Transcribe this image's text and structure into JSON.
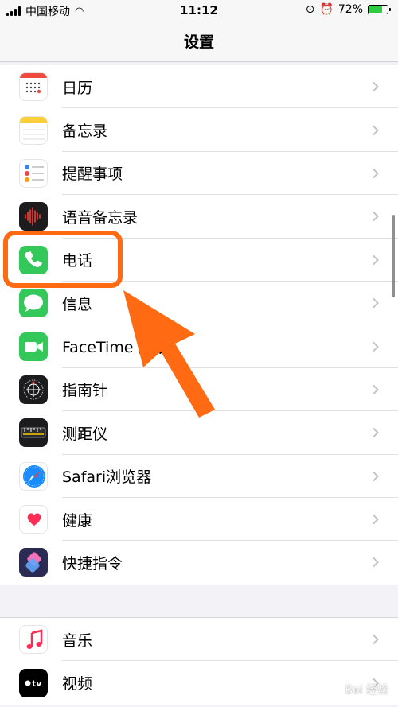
{
  "status_bar": {
    "carrier": "中国移动",
    "time": "11:12",
    "battery": "72%",
    "battery_level": 0.72
  },
  "nav": {
    "title": "设置"
  },
  "group1": {
    "items": [
      {
        "label": "日历",
        "icon": "calendar-icon"
      },
      {
        "label": "备忘录",
        "icon": "notes-icon"
      },
      {
        "label": "提醒事项",
        "icon": "reminders-icon"
      },
      {
        "label": "语音备忘录",
        "icon": "voice-memos-icon"
      },
      {
        "label": "电话",
        "icon": "phone-icon"
      },
      {
        "label": "信息",
        "icon": "messages-icon"
      },
      {
        "label": "FaceTime 通话",
        "icon": "facetime-icon"
      },
      {
        "label": "指南针",
        "icon": "compass-icon"
      },
      {
        "label": "测距仪",
        "icon": "measure-icon"
      },
      {
        "label": "Safari浏览器",
        "icon": "safari-icon"
      },
      {
        "label": "健康",
        "icon": "health-icon"
      },
      {
        "label": "快捷指令",
        "icon": "shortcuts-icon"
      }
    ]
  },
  "group2": {
    "items": [
      {
        "label": "音乐",
        "icon": "music-icon"
      },
      {
        "label": "视频",
        "icon": "tv-icon"
      }
    ]
  },
  "watermark": "Bai 经验"
}
